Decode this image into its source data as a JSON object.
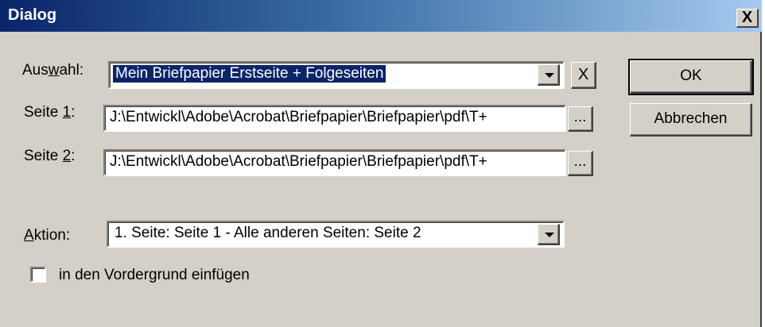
{
  "dialog": {
    "title": "Dialog",
    "close_label": "X"
  },
  "auswahl": {
    "label_pre": "Aus",
    "label_accel": "w",
    "label_post": "ahl:",
    "value": "Mein Briefpapier Erstseite + Folgeseiten",
    "clear_label": "X"
  },
  "seite1": {
    "label_pre": "Seite ",
    "label_accel": "1",
    "label_post": ":",
    "value": "J:\\Entwickl\\Adobe\\Acrobat\\Briefpapier\\Briefpapier\\pdf\\T+",
    "browse_label": "..."
  },
  "seite2": {
    "label_pre": "Seite ",
    "label_accel": "2",
    "label_post": ":",
    "value": "J:\\Entwickl\\Adobe\\Acrobat\\Briefpapier\\Briefpapier\\pdf\\T+",
    "browse_label": "..."
  },
  "aktion": {
    "label_accel": "A",
    "label_post": "ktion:",
    "value": "1. Seite: Seite 1 - Alle anderen Seiten: Seite 2"
  },
  "foreground": {
    "label": "in den Vordergrund einfügen",
    "checked": false
  },
  "buttons": {
    "ok": "OK",
    "cancel": "Abbrechen"
  }
}
